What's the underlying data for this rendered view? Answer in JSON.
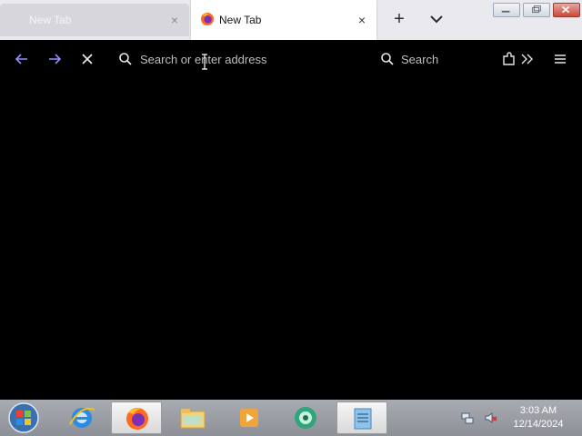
{
  "tabs": [
    {
      "title": "New Tab",
      "close": "×",
      "active": false
    },
    {
      "title": "New Tab",
      "close": "×",
      "active": true
    }
  ],
  "toolbar": {
    "new_tab": "+",
    "url_placeholder": "Search or enter address",
    "search_placeholder": "Search"
  },
  "icons": {
    "back": "arrow-left-icon",
    "forward": "arrow-right-icon",
    "stop": "close-icon",
    "extensions": "puzzle-icon",
    "overflow": "chevrons-right-icon",
    "menu": "hamburger-icon"
  },
  "colors": {
    "toolbar_icon": "#8f8fff",
    "window_close": "#c9483a",
    "active_tab": "#ffffff"
  },
  "taskbar": {
    "items": [
      "start-orb",
      "internet-explorer",
      "firefox",
      "file-explorer",
      "media-player",
      "app-green",
      "app-blue"
    ]
  },
  "clock": {
    "time": "3:03 AM",
    "date": "12/14/2024"
  }
}
